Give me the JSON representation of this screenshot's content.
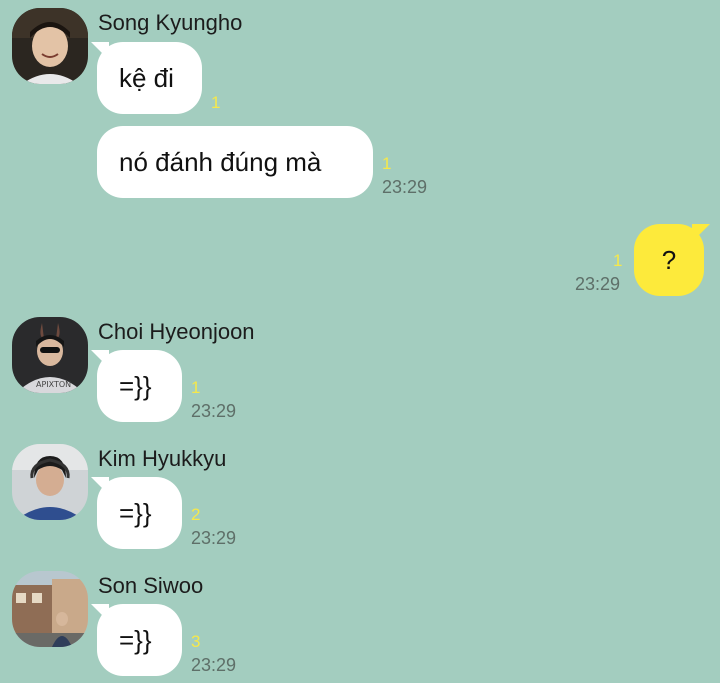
{
  "colors": {
    "background": "#a3cdbf",
    "bubble_other": "#ffffff",
    "bubble_mine": "#fdea3b",
    "unread": "#f6e84a",
    "timestamp": "#5e6f68"
  },
  "messages": [
    {
      "sender": "Song Kyungho",
      "bubbles": [
        {
          "text": "kệ đi",
          "unread": "1"
        },
        {
          "text": "nó đánh đúng mà",
          "unread": "1",
          "time": "23:29"
        }
      ]
    },
    {
      "sender": "me",
      "bubbles": [
        {
          "text": "?",
          "unread": "1",
          "time": "23:29"
        }
      ]
    },
    {
      "sender": "Choi Hyeonjoon",
      "bubbles": [
        {
          "text": "=}}",
          "unread": "1",
          "time": "23:29"
        }
      ]
    },
    {
      "sender": "Kim Hyukkyu",
      "bubbles": [
        {
          "text": "=}}",
          "unread": "2",
          "time": "23:29"
        }
      ]
    },
    {
      "sender": "Son Siwoo",
      "bubbles": [
        {
          "text": "=}}",
          "unread": "3",
          "time": "23:29"
        }
      ]
    }
  ]
}
